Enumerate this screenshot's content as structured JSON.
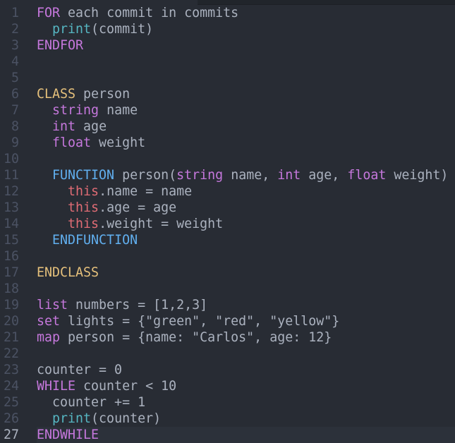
{
  "editor": {
    "current_line": 27,
    "colors": {
      "background": "#282c34",
      "gutter_text": "#4b5263",
      "text": "#abb2bf",
      "keyword": "#c678dd",
      "class_keyword": "#e5c07b",
      "function_keyword": "#61afef",
      "this_keyword": "#e06c75",
      "builtin_call": "#56b6c2",
      "current_line_bg": "#2c313a"
    },
    "lines": [
      {
        "n": "1",
        "tokens": [
          {
            "t": "FOR",
            "c": "kw"
          },
          {
            "t": " each commit in commits",
            "c": "plain"
          }
        ]
      },
      {
        "n": "2",
        "tokens": [
          {
            "t": "  ",
            "c": "plain"
          },
          {
            "t": "print",
            "c": "call"
          },
          {
            "t": "(commit)",
            "c": "plain"
          }
        ]
      },
      {
        "n": "3",
        "tokens": [
          {
            "t": "ENDFOR",
            "c": "kw"
          }
        ]
      },
      {
        "n": "4",
        "tokens": []
      },
      {
        "n": "5",
        "tokens": []
      },
      {
        "n": "6",
        "tokens": [
          {
            "t": "CLASS",
            "c": "cls"
          },
          {
            "t": " person",
            "c": "plain"
          }
        ]
      },
      {
        "n": "7",
        "tokens": [
          {
            "t": "  ",
            "c": "plain"
          },
          {
            "t": "string",
            "c": "kw"
          },
          {
            "t": " name",
            "c": "plain"
          }
        ]
      },
      {
        "n": "8",
        "tokens": [
          {
            "t": "  ",
            "c": "plain"
          },
          {
            "t": "int",
            "c": "kw"
          },
          {
            "t": " age",
            "c": "plain"
          }
        ]
      },
      {
        "n": "9",
        "tokens": [
          {
            "t": "  ",
            "c": "plain"
          },
          {
            "t": "float",
            "c": "kw"
          },
          {
            "t": " weight",
            "c": "plain"
          }
        ]
      },
      {
        "n": "10",
        "tokens": []
      },
      {
        "n": "11",
        "tokens": [
          {
            "t": "  ",
            "c": "plain"
          },
          {
            "t": "FUNCTION",
            "c": "fn"
          },
          {
            "t": " person(",
            "c": "plain"
          },
          {
            "t": "string",
            "c": "kw"
          },
          {
            "t": " name, ",
            "c": "plain"
          },
          {
            "t": "int",
            "c": "kw"
          },
          {
            "t": " age, ",
            "c": "plain"
          },
          {
            "t": "float",
            "c": "kw"
          },
          {
            "t": " weight)",
            "c": "plain"
          }
        ]
      },
      {
        "n": "12",
        "tokens": [
          {
            "t": "    ",
            "c": "plain"
          },
          {
            "t": "this",
            "c": "this"
          },
          {
            "t": ".name = name",
            "c": "plain"
          }
        ]
      },
      {
        "n": "13",
        "tokens": [
          {
            "t": "    ",
            "c": "plain"
          },
          {
            "t": "this",
            "c": "this"
          },
          {
            "t": ".age = age",
            "c": "plain"
          }
        ]
      },
      {
        "n": "14",
        "tokens": [
          {
            "t": "    ",
            "c": "plain"
          },
          {
            "t": "this",
            "c": "this"
          },
          {
            "t": ".weight = weight",
            "c": "plain"
          }
        ]
      },
      {
        "n": "15",
        "tokens": [
          {
            "t": "  ",
            "c": "plain"
          },
          {
            "t": "ENDFUNCTION",
            "c": "fn"
          }
        ]
      },
      {
        "n": "16",
        "tokens": []
      },
      {
        "n": "17",
        "tokens": [
          {
            "t": "ENDCLASS",
            "c": "cls"
          }
        ]
      },
      {
        "n": "18",
        "tokens": []
      },
      {
        "n": "19",
        "tokens": [
          {
            "t": "list",
            "c": "kw"
          },
          {
            "t": " numbers = [1,2,3]",
            "c": "plain"
          }
        ]
      },
      {
        "n": "20",
        "tokens": [
          {
            "t": "set",
            "c": "kw"
          },
          {
            "t": " lights = {\"green\", \"red\", \"yellow\"}",
            "c": "plain"
          }
        ]
      },
      {
        "n": "21",
        "tokens": [
          {
            "t": "map",
            "c": "kw"
          },
          {
            "t": " person = {name: \"Carlos\", age: 12}",
            "c": "plain"
          }
        ]
      },
      {
        "n": "22",
        "tokens": []
      },
      {
        "n": "23",
        "tokens": [
          {
            "t": "counter = 0",
            "c": "plain"
          }
        ]
      },
      {
        "n": "24",
        "tokens": [
          {
            "t": "WHILE",
            "c": "kw"
          },
          {
            "t": " counter < 10",
            "c": "plain"
          }
        ]
      },
      {
        "n": "25",
        "tokens": [
          {
            "t": "  counter += 1",
            "c": "plain"
          }
        ]
      },
      {
        "n": "26",
        "tokens": [
          {
            "t": "  ",
            "c": "plain"
          },
          {
            "t": "print",
            "c": "call"
          },
          {
            "t": "(counter)",
            "c": "plain"
          }
        ]
      },
      {
        "n": "27",
        "tokens": [
          {
            "t": "ENDWHILE",
            "c": "kw"
          }
        ]
      }
    ]
  }
}
